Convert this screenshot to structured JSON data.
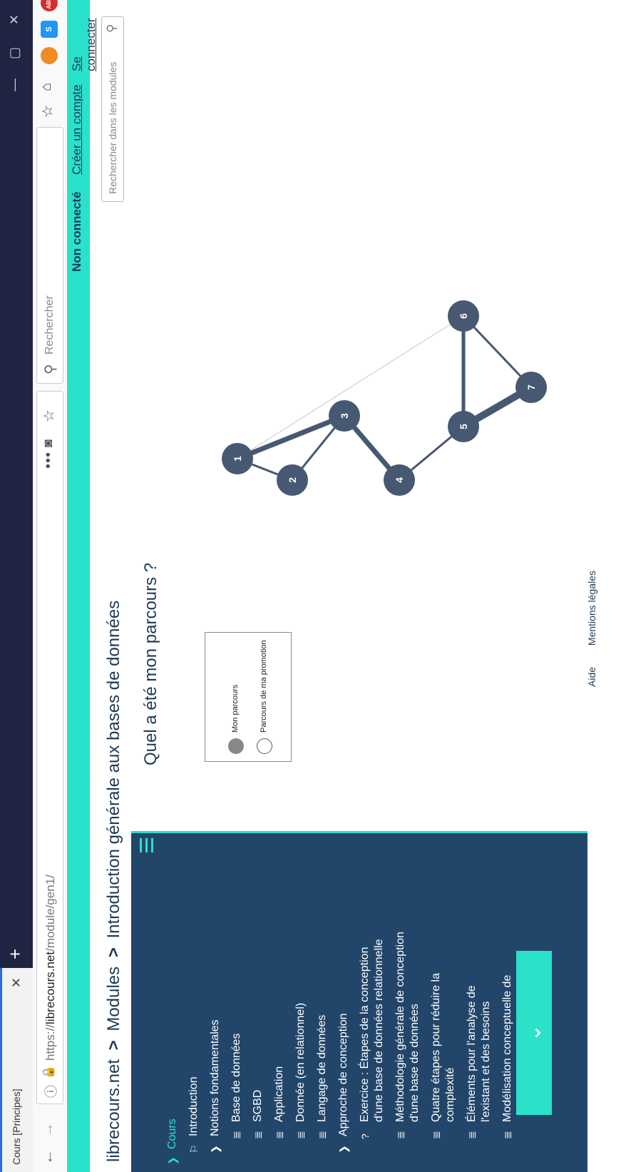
{
  "browser": {
    "tab_title": "Cours [Principes]",
    "url_scheme": "https://",
    "url_host": "librecours.net",
    "url_path": "/module/gen1/",
    "search_placeholder": "Rechercher",
    "ext_abp": "ABP",
    "ext_s": "S"
  },
  "site": {
    "status": "Non connecté",
    "create_account": "Créer un compte",
    "login": "Se connecter",
    "module_search_placeholder": "Rechercher dans les modules"
  },
  "breadcrumb": {
    "home": "librecours.net",
    "sep": ">",
    "modules": "Modules",
    "current": "Introduction générale aux bases de données"
  },
  "page_title": "Quel a été mon parcours ?",
  "legend": {
    "item1": "Mon parcours",
    "item2": "Parcours de ma promotion"
  },
  "sidebar": {
    "items": [
      {
        "label": "Cours",
        "icon": "chevron-down-icon"
      },
      {
        "label": "Introduction",
        "icon": "flag-icon"
      },
      {
        "label": "Notions fondamentales",
        "icon": "chevron-down-icon"
      },
      {
        "label": "Base de données",
        "icon": "list-icon"
      },
      {
        "label": "SGBD",
        "icon": "list-icon"
      },
      {
        "label": "Application",
        "icon": "list-icon"
      },
      {
        "label": "Donnée (en relationnel)",
        "icon": "list-icon"
      },
      {
        "label": "Langage de données",
        "icon": "list-icon"
      },
      {
        "label": "Approche de conception",
        "icon": "chevron-down-icon"
      },
      {
        "label": "Exercice : Étapes de la conception d'une base de données relationnelle",
        "icon": "question-icon"
      },
      {
        "label": "Méthodologie générale de conception d'une base de données",
        "icon": "list-icon"
      },
      {
        "label": "Quatre étapes pour réduire la complexité",
        "icon": "list-icon"
      },
      {
        "label": "Éléments pour l'analyse de l'existant et des besoins",
        "icon": "list-icon"
      },
      {
        "label": "Modélisation conceptuelle de",
        "icon": "list-icon"
      }
    ]
  },
  "graph": {
    "nodes": [
      "1",
      "2",
      "3",
      "4",
      "5",
      "6",
      "7"
    ]
  },
  "footer": {
    "help": "Aide",
    "legal": "Mentions légales"
  },
  "colors": {
    "accent": "#29e2c9",
    "navy": "#22466a",
    "node": "#475872"
  }
}
